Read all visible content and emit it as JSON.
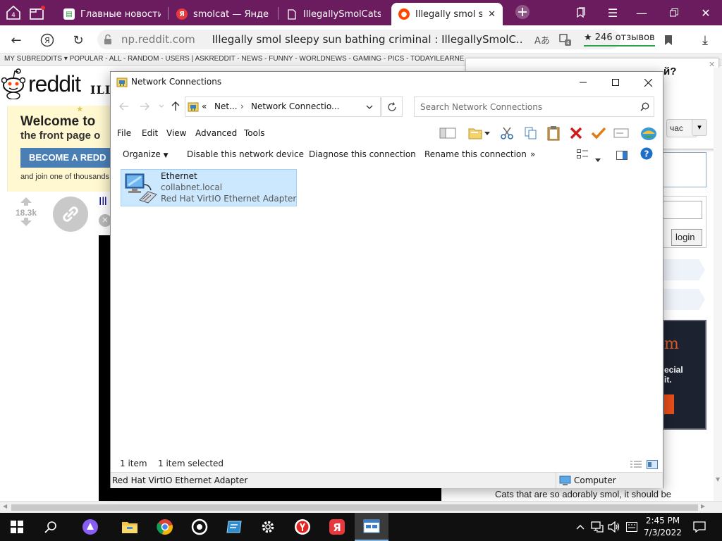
{
  "browser": {
    "tab_count": "4",
    "tabs": [
      {
        "title": "Главные новости К",
        "favicon": "news-icon",
        "active": false
      },
      {
        "title": "smolcat — Яндекс",
        "favicon": "yandex-icon",
        "active": false
      },
      {
        "title": "IllegallySmolCats",
        "favicon": "page-icon",
        "active": false
      },
      {
        "title": "Illegally smol slee",
        "favicon": "reddit-icon",
        "active": true
      }
    ],
    "domain": "np.reddit.com",
    "page_title": "Illegally smol sleepy sun bathing criminal : IllegallySmolC...",
    "reviews": "★ 246 отзывов",
    "colors": {
      "tab_strip": "#6b1c5f",
      "reviews_underline": "#2aa14b"
    }
  },
  "reddit": {
    "subreddit_bar": "MY SUBREDDITS ▾    POPULAR  -  ALL  -  RANDOM  -  USERS   |   ASKREDDIT  -  NEWS  -  FUNNY  -  WORLDNEWS  -  GAMING  -  PICS  -  TODAYILEARNE",
    "logo_text": "reddit",
    "subreddit_title": "ILLE",
    "welcome_title": "Welcome to",
    "welcome_sub": "the front page o",
    "become_button": "BECOME A REDD",
    "join_text": "and join one of thousands",
    "vote_count": "18.3k",
    "post_title_fragment": "Ill",
    "popup_fragment": "й?",
    "right_button": "час",
    "login_button": "login",
    "right_banner_text": "m",
    "right_banner_sub": "ecial",
    "right_banner_sub2": "it.",
    "description": "Cats that are so adorably smol, it should be"
  },
  "window": {
    "title": "Network Connections",
    "breadcrumb": {
      "prefix": "«",
      "part1": "Net...",
      "part2": "Network Connectio..."
    },
    "search_placeholder": "Search Network Connections",
    "menu": [
      "File",
      "Edit",
      "View",
      "Advanced",
      "Tools"
    ],
    "commands": {
      "organize": "Organize",
      "disable": "Disable this network device",
      "diagnose": "Diagnose this connection",
      "rename": "Rename this connection",
      "more": "»"
    },
    "items": [
      {
        "name": "Ethernet",
        "domain": "collabnet.local",
        "adapter": "Red Hat VirtIO Ethernet Adapter",
        "selected": true
      }
    ],
    "status": {
      "count": "1 item",
      "selected": "1 item selected"
    },
    "details": {
      "left": "Red Hat VirtIO Ethernet Adapter",
      "right": "Computer"
    }
  },
  "taskbar": {
    "time": "2:45 PM",
    "date": "7/3/2022"
  }
}
